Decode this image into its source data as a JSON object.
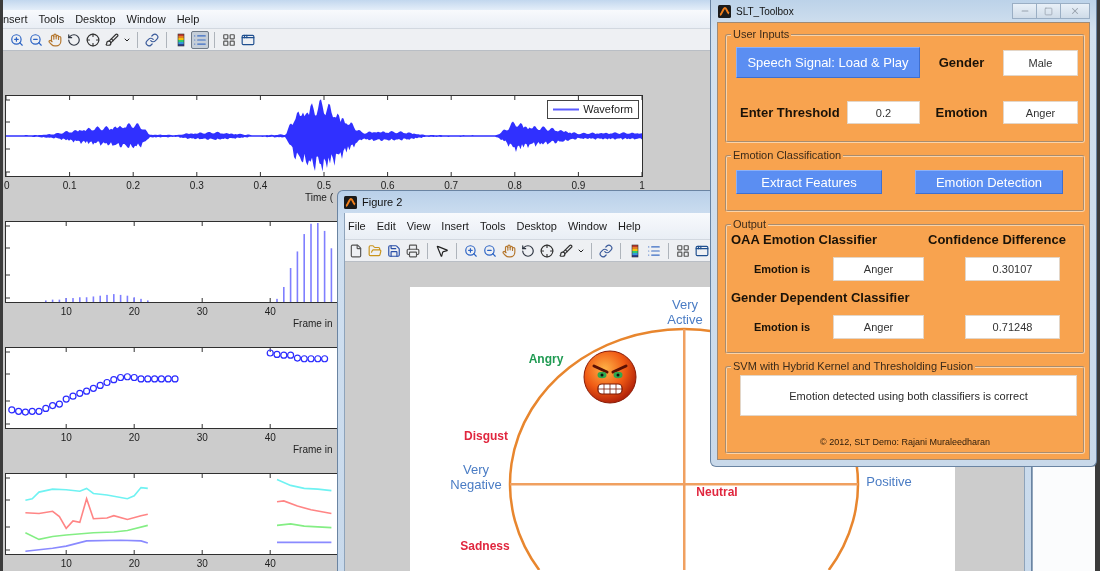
{
  "figure_1": {
    "menu": [
      "nsert",
      "Tools",
      "Desktop",
      "Window",
      "Help"
    ],
    "toolbar": [
      [
        {
          "kind": "zoom-in",
          "pressed": false
        },
        {
          "kind": "zoom-out",
          "pressed": false
        },
        {
          "kind": "pan",
          "pressed": false
        },
        {
          "kind": "rotate",
          "pressed": false
        },
        {
          "kind": "data-cursor",
          "pressed": false
        },
        {
          "kind": "brush",
          "pressed": false
        },
        {
          "kind": "dropdown",
          "pressed": false
        }
      ],
      [
        {
          "kind": "link",
          "pressed": false
        }
      ],
      [
        {
          "kind": "colorbar",
          "pressed": false
        },
        {
          "kind": "legend",
          "pressed": true
        }
      ],
      [
        {
          "kind": "hide-tools",
          "pressed": false
        },
        {
          "kind": "show-tools",
          "pressed": false
        }
      ]
    ],
    "plots": [
      {
        "kind": "waveform",
        "legend": "Waveform",
        "xticks": [
          "0",
          "0.1",
          "0.2",
          "0.3",
          "0.4",
          "0.5",
          "0.6",
          "0.7",
          "0.8",
          "0.9",
          "1"
        ],
        "xlabel": "Time ("
      },
      {
        "kind": "stem",
        "xticks": [
          "10",
          "20",
          "30",
          "40"
        ],
        "xlabel": "Frame in"
      },
      {
        "kind": "markers",
        "xticks": [
          "10",
          "20",
          "30",
          "40"
        ],
        "xlabel": "Frame in"
      },
      {
        "kind": "lines",
        "xticks": [
          "10",
          "20",
          "30",
          "40"
        ]
      }
    ]
  },
  "figure_2": {
    "title": "Figure 2",
    "menu": [
      "File",
      "Edit",
      "View",
      "Insert",
      "Tools",
      "Desktop",
      "Window",
      "Help"
    ],
    "toolbar": [
      [
        {
          "kind": "new",
          "pressed": false
        },
        {
          "kind": "open",
          "pressed": false
        },
        {
          "kind": "save",
          "pressed": false
        },
        {
          "kind": "print",
          "pressed": false
        }
      ],
      [
        {
          "kind": "pointer",
          "pressed": false
        }
      ],
      [
        {
          "kind": "zoom-in",
          "pressed": false
        },
        {
          "kind": "zoom-out",
          "pressed": false
        },
        {
          "kind": "pan",
          "pressed": false
        },
        {
          "kind": "rotate",
          "pressed": false
        },
        {
          "kind": "data-cursor",
          "pressed": false
        },
        {
          "kind": "brush",
          "pressed": false
        },
        {
          "kind": "dropdown",
          "pressed": false
        }
      ],
      [
        {
          "kind": "link",
          "pressed": false
        }
      ],
      [
        {
          "kind": "colorbar",
          "pressed": false
        },
        {
          "kind": "legend",
          "pressed": false
        }
      ],
      [
        {
          "kind": "hide-tools",
          "pressed": false
        },
        {
          "kind": "show-tools",
          "pressed": false
        }
      ]
    ],
    "diagram": {
      "labels": [
        {
          "text": "Very Active",
          "kind": "pole",
          "color": "#4a7cc4"
        },
        {
          "text": "Angry",
          "kind": "emotion",
          "color": "#1f9a52"
        },
        {
          "text": "Disgust",
          "kind": "emotion",
          "color": "#e0263e"
        },
        {
          "text": "Very Negative",
          "kind": "pole",
          "color": "#4a7cc4"
        },
        {
          "text": "Positive",
          "kind": "pole",
          "color": "#4a7cc4"
        },
        {
          "text": "Neutral",
          "kind": "emotion",
          "color": "#e0263e"
        },
        {
          "text": "Sadness",
          "kind": "emotion",
          "color": "#e0263e"
        }
      ]
    }
  },
  "toolbox": {
    "title": "SLT_Toolbox",
    "user_inputs": {
      "title": "User Inputs",
      "load_button": "Speech Signal: Load & Play",
      "gender_label": "Gender",
      "gender": "Male",
      "threshold_label": "Enter Threshold",
      "threshold": "0.2",
      "emotion_label": "Emotion",
      "emotion": "Anger"
    },
    "classification": {
      "title": "Emotion Classification",
      "buttons": [
        "Extract Features",
        "Emotion Detection"
      ]
    },
    "output": {
      "title": "Output",
      "confidence_label": "Confidence Difference",
      "classifiers": [
        {
          "name": "OAA Emotion Classifier",
          "row_label": "Emotion is",
          "emotion": "Anger",
          "confidence": "0.30107"
        },
        {
          "name": "Gender Dependent Classifier",
          "row_label": "Emotion is",
          "emotion": "Anger",
          "confidence": "0.71248"
        }
      ]
    },
    "fusion": {
      "title": "SVM with Hybrid Kernel and Thresholding Fusion",
      "result": "Emotion detected using both classifiers is correct"
    },
    "footer": "© 2012, SLT Demo: Rajani Muraleedharan"
  }
}
